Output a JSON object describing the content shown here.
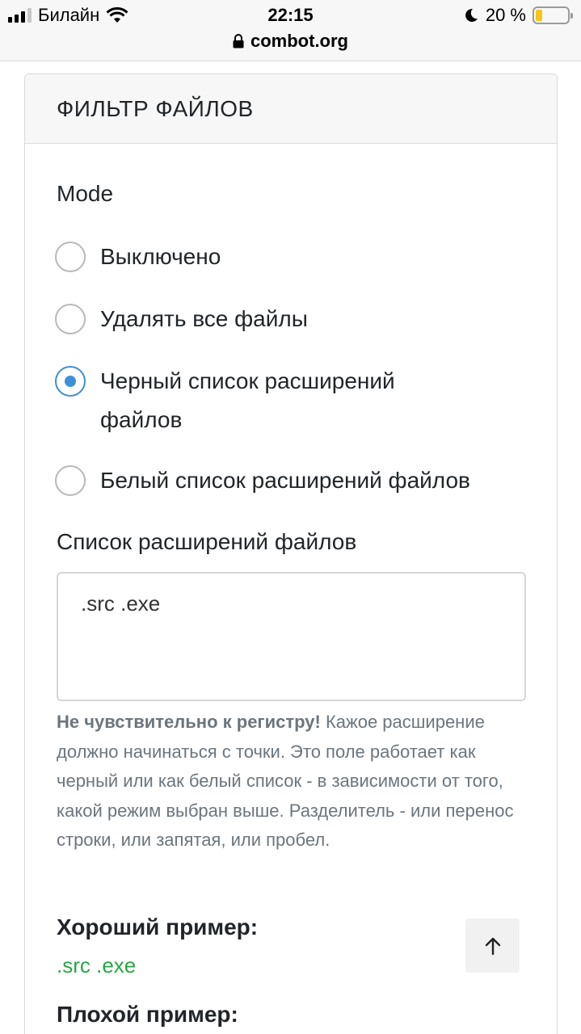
{
  "status_bar": {
    "carrier": "Билайн",
    "time": "22:15",
    "battery_text": "20 %",
    "battery_level": 0.2,
    "url": "combot.org"
  },
  "card": {
    "header": "ФИЛЬТР ФАЙЛОВ",
    "mode_label": "Mode",
    "options": [
      {
        "label": "Выключено",
        "checked": false
      },
      {
        "label": "Удалять все файлы",
        "checked": false
      },
      {
        "label": "Черный список расширений файлов",
        "checked": true
      },
      {
        "label": "Белый список расширений файлов",
        "checked": false
      }
    ],
    "extensions_label": "Список расширений файлов",
    "extensions_value": ".src .exe",
    "help_bold": "Не чувствительно к регистру!",
    "help_text": " Кажое расширение должно начинаться с точки. Это поле работает как черный или как белый список - в зависимости от того, какой режим выбран выше. Разделитель - или перенос строки, или запятая, или пробел.",
    "good_example_title": "Хороший пример:",
    "good_example_value": ".src .exe",
    "bad_example_title": "Плохой пример:"
  },
  "colors": {
    "accent": "#3d8fd8",
    "good_example": "#28a745",
    "muted_text": "#6c757d"
  },
  "icons": {
    "scroll_top": "arrow-up-icon"
  }
}
